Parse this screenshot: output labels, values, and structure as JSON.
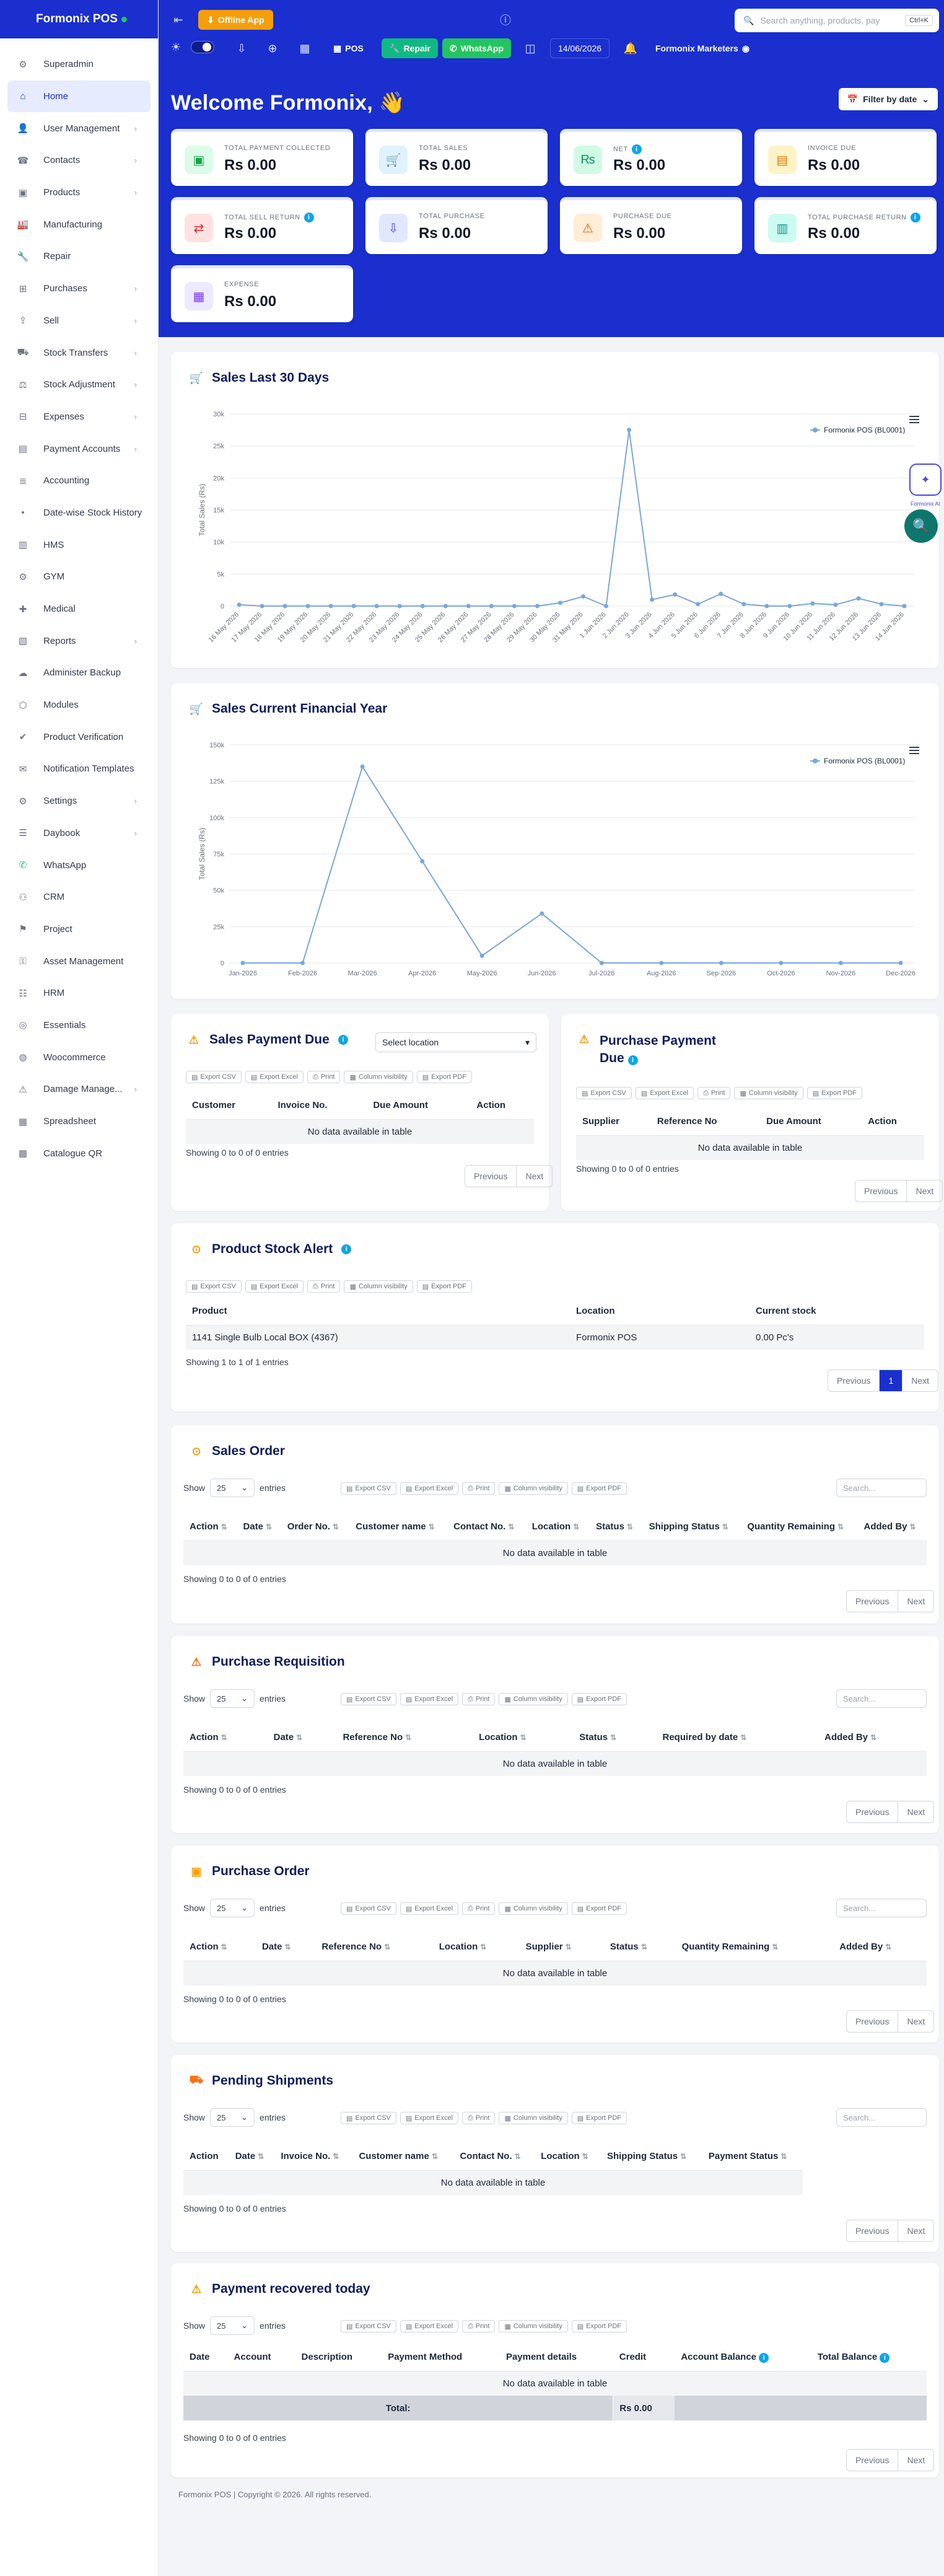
{
  "app": {
    "brand": "Formonix POS"
  },
  "sidebar": {
    "items": [
      {
        "label": "Superadmin",
        "icon": "superadmin-icon",
        "chev": false
      },
      {
        "label": "Home",
        "icon": "home-icon",
        "chev": false,
        "active": true
      },
      {
        "label": "User Management",
        "icon": "users-icon",
        "chev": true
      },
      {
        "label": "Contacts",
        "icon": "contacts-icon",
        "chev": true
      },
      {
        "label": "Products",
        "icon": "products-icon",
        "chev": true
      },
      {
        "label": "Manufacturing",
        "icon": "factory-icon",
        "chev": false
      },
      {
        "label": "Repair",
        "icon": "wrench-icon",
        "chev": false
      },
      {
        "label": "Purchases",
        "icon": "purchase-icon",
        "chev": true
      },
      {
        "label": "Sell",
        "icon": "sell-icon",
        "chev": true
      },
      {
        "label": "Stock Transfers",
        "icon": "truck-icon",
        "chev": true
      },
      {
        "label": "Stock Adjustment",
        "icon": "adjust-icon",
        "chev": true
      },
      {
        "label": "Expenses",
        "icon": "expense-icon",
        "chev": true
      },
      {
        "label": "Payment Accounts",
        "icon": "payment-icon",
        "chev": true
      },
      {
        "label": "Accounting",
        "icon": "accounting-icon",
        "chev": false
      },
      {
        "label": "Date-wise Stock History",
        "icon": "history-icon",
        "chev": false
      },
      {
        "label": "HMS",
        "icon": "hms-icon",
        "chev": false
      },
      {
        "label": "GYM",
        "icon": "gym-icon",
        "chev": false
      },
      {
        "label": "Medical",
        "icon": "medical-icon",
        "chev": false
      },
      {
        "label": "Reports",
        "icon": "reports-icon",
        "chev": true
      },
      {
        "label": "Administer Backup",
        "icon": "backup-icon",
        "chev": false
      },
      {
        "label": "Modules",
        "icon": "modules-icon",
        "chev": false
      },
      {
        "label": "Product Verification",
        "icon": "verify-icon",
        "chev": false
      },
      {
        "label": "Notification Templates",
        "icon": "envelope-icon",
        "chev": false
      },
      {
        "label": "Settings",
        "icon": "settings-icon",
        "chev": true
      },
      {
        "label": "Daybook",
        "icon": "daybook-icon",
        "chev": true
      },
      {
        "label": "WhatsApp",
        "icon": "whatsapp-icon",
        "chev": false
      },
      {
        "label": "CRM",
        "icon": "crm-icon",
        "chev": false
      },
      {
        "label": "Project",
        "icon": "project-icon",
        "chev": false
      },
      {
        "label": "Asset Management",
        "icon": "asset-icon",
        "chev": false
      },
      {
        "label": "HRM",
        "icon": "hrm-icon",
        "chev": false
      },
      {
        "label": "Essentials",
        "icon": "essentials-icon",
        "chev": false
      },
      {
        "label": "Woocommerce",
        "icon": "woo-icon",
        "chev": false
      },
      {
        "label": "Damage Manage...",
        "icon": "damage-icon",
        "chev": true
      },
      {
        "label": "Spreadsheet",
        "icon": "spreadsheet-icon",
        "chev": false
      },
      {
        "label": "Catalogue QR",
        "icon": "qr-icon",
        "chev": false
      }
    ]
  },
  "topbar": {
    "offline": "Offline App",
    "search_placeholder": "Search anything, products, pay",
    "kbd": "Ctrl+K",
    "pos": "POS",
    "repair": "Repair",
    "whatsapp": "WhatsApp",
    "date": "14/06/2026",
    "business": "Formonix Marketers"
  },
  "hero": {
    "welcome": "Welcome Formonix, 👋",
    "filter": "Filter by date"
  },
  "cards": [
    {
      "label": "TOTAL PAYMENT COLLECTED",
      "value": "Rs 0.00",
      "icon": "wallet-icon",
      "color": "#16a34a",
      "bg": "#dcfce7",
      "info": false
    },
    {
      "label": "TOTAL SALES",
      "value": "Rs 0.00",
      "icon": "cart-icon",
      "color": "#0284c7",
      "bg": "#e0f2fe",
      "info": false
    },
    {
      "label": "NET",
      "value": "Rs 0.00",
      "icon": "rupee-icon",
      "color": "#059669",
      "bg": "#d1fae5",
      "info": true
    },
    {
      "label": "INVOICE DUE",
      "value": "Rs 0.00",
      "icon": "invoice-icon",
      "color": "#d97706",
      "bg": "#fef3c7",
      "info": false
    },
    {
      "label": "TOTAL SELL RETURN",
      "value": "Rs 0.00",
      "icon": "swap-icon",
      "color": "#dc2626",
      "bg": "#fee2e2",
      "info": true
    },
    {
      "label": "TOTAL PURCHASE",
      "value": "Rs 0.00",
      "icon": "download-icon",
      "color": "#4f46e5",
      "bg": "#e0e7ff",
      "info": false
    },
    {
      "label": "PURCHASE DUE",
      "value": "Rs 0.00",
      "icon": "warning-icon",
      "color": "#ea580c",
      "bg": "#ffedd5",
      "info": false
    },
    {
      "label": "TOTAL PURCHASE RETURN",
      "value": "Rs 0.00",
      "icon": "return-icon",
      "color": "#0d9488",
      "bg": "#ccfbf1",
      "info": true
    },
    {
      "label": "EXPENSE",
      "value": "Rs 0.00",
      "icon": "expense-icon",
      "color": "#7c3aed",
      "bg": "#ede9fe",
      "info": false
    }
  ],
  "charts": {
    "sales30": {
      "title": "Sales Last 30 Days",
      "legend": "Formonix POS (BL0001)"
    },
    "salesFY": {
      "title": "Sales Current Financial Year",
      "legend": "Formonix POS (BL0001)"
    }
  },
  "chart_data": [
    {
      "type": "line",
      "title": "Sales Last 30 Days",
      "ylabel": "Total Sales (Rs)",
      "ylim": [
        0,
        30000
      ],
      "yticks": [
        "0",
        "5k",
        "10k",
        "15k",
        "20k",
        "25k",
        "30k"
      ],
      "x": [
        "16 May 2026",
        "17 May 2026",
        "18 May 2026",
        "19 May 2026",
        "20 May 2026",
        "21 May 2026",
        "22 May 2026",
        "23 May 2026",
        "24 May 2026",
        "25 May 2026",
        "26 May 2026",
        "27 May 2026",
        "28 May 2026",
        "29 May 2026",
        "30 May 2026",
        "31 May 2026",
        "1 Jun 2026",
        "2 Jun 2026",
        "3 Jun 2026",
        "4 Jun 2026",
        "5 Jun 2026",
        "6 Jun 2026",
        "7 Jun 2026",
        "8 Jun 2026",
        "9 Jun 2026",
        "10 Jun 2026",
        "11 Jun 2026",
        "12 Jun 2026",
        "13 Jun 2026",
        "14 Jun 2026"
      ],
      "series": [
        {
          "name": "Formonix POS (BL0001)",
          "values": [
            200,
            0,
            0,
            0,
            0,
            0,
            0,
            0,
            0,
            0,
            0,
            0,
            0,
            0,
            500,
            1500,
            0,
            27500,
            1000,
            1800,
            300,
            1900,
            300,
            0,
            0,
            400,
            200,
            1200,
            300,
            0
          ]
        }
      ],
      "legend": "top-right"
    },
    {
      "type": "line",
      "title": "Sales Current Financial Year",
      "ylabel": "Total Sales (Rs)",
      "ylim": [
        0,
        150000
      ],
      "yticks": [
        "0",
        "25k",
        "50k",
        "75k",
        "100k",
        "125k",
        "150k"
      ],
      "x": [
        "Jan-2026",
        "Feb-2026",
        "Mar-2026",
        "Apr-2026",
        "May-2026",
        "Jun-2026",
        "Jul-2026",
        "Aug-2026",
        "Sep-2026",
        "Oct-2026",
        "Nov-2026",
        "Dec-2026"
      ],
      "series": [
        {
          "name": "Formonix POS (BL0001)",
          "values": [
            0,
            0,
            135000,
            70000,
            5000,
            34000,
            0,
            0,
            0,
            0,
            0,
            0
          ]
        }
      ],
      "legend": "top-right"
    }
  ],
  "export": {
    "csv": "Export CSV",
    "excel": "Export Excel",
    "print": "Print",
    "colvis": "Column visibility",
    "pdf": "Export PDF"
  },
  "common": {
    "nodata": "No data available in table",
    "showing0": "Showing 0 to 0 of 0 entries",
    "previous": "Previous",
    "next": "Next",
    "show": "Show",
    "entries": "entries",
    "entries_val": "25",
    "search": "Search..."
  },
  "salesDue": {
    "title": "Sales Payment Due",
    "location": "Select location",
    "cols": [
      "Customer",
      "Invoice No.",
      "Due Amount",
      "Action"
    ]
  },
  "purchaseDue": {
    "title": "Purchase Payment Due",
    "cols": [
      "Supplier",
      "Reference No",
      "Due Amount",
      "Action"
    ]
  },
  "stockAlert": {
    "title": "Product Stock Alert",
    "cols": [
      "Product",
      "Location",
      "Current stock"
    ],
    "row": [
      "1141 Single Bulb Local BOX (4367)",
      "Formonix POS",
      "0.00 Pc's"
    ],
    "showing": "Showing 1 to 1 of 1 entries",
    "page": "1"
  },
  "salesOrder": {
    "title": "Sales Order",
    "cols": [
      "Action",
      "Date",
      "Order No.",
      "Customer name",
      "Contact No.",
      "Location",
      "Status",
      "Shipping Status",
      "Quantity Remaining",
      "Added By"
    ]
  },
  "purchaseReq": {
    "title": "Purchase Requisition",
    "cols": [
      "Action",
      "Date",
      "Reference No",
      "Location",
      "Status",
      "Required by date",
      "Added By"
    ]
  },
  "purchaseOrder": {
    "title": "Purchase Order",
    "cols": [
      "Action",
      "Date",
      "Reference No",
      "Location",
      "Supplier",
      "Status",
      "Quantity Remaining",
      "Added By"
    ]
  },
  "pending": {
    "title": "Pending Shipments",
    "cols": [
      "Action",
      "Date",
      "Invoice No.",
      "Customer name",
      "Contact No.",
      "Location",
      "Shipping Status",
      "Payment Status"
    ]
  },
  "recovered": {
    "title": "Payment recovered today",
    "cols": [
      "Date",
      "Account",
      "Description",
      "Payment Method",
      "Payment details",
      "Credit",
      "Account Balance",
      "Total Balance"
    ],
    "total_label": "Total:",
    "total_value": "Rs 0.00"
  },
  "footer": "Formonix POS | Copyright © 2026. All rights reserved.",
  "ai_label": "Formonix AI"
}
